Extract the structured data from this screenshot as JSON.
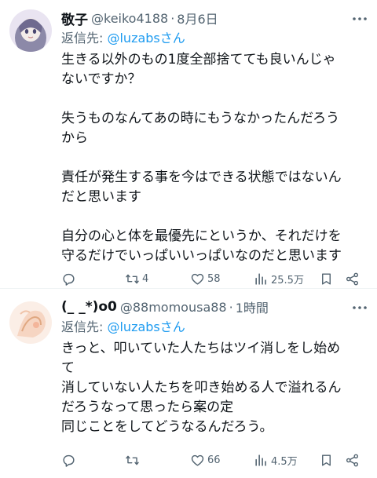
{
  "tweets": [
    {
      "name": "敬子",
      "handle": "@keiko4188",
      "separator": "·",
      "date": "8月6日",
      "reply_prefix": "返信先: ",
      "reply_to": "@luzabsさん",
      "body_lines": [
        "生きる以外のもの1度全部捨てても良いんじゃ",
        "ないですか？",
        "",
        "失うものなんてあの時にもうなかったんだろう",
        "から",
        "",
        "責任が発生する事を今はできる状態ではないん",
        "だと思います",
        "",
        "自分の心と体を最優先にというか、それだけを",
        "守るだけでいっぱいいっぱいなのだと思います"
      ],
      "replies": "",
      "retweets": "4",
      "likes": "58",
      "views": "25.5万"
    },
    {
      "name": "(_ _*)o0",
      "handle": "@88momousa88",
      "separator": "·",
      "date": "1時間",
      "reply_prefix": "返信先: ",
      "reply_to": "@luzabsさん",
      "body_lines": [
        "きっと、叩いていた人たちはツイ消しをし始め",
        "て",
        "消していない人たちを叩き始める人で溢れるん",
        "だろうなって思ったら案の定",
        "同じことをしてどうなるんだろう。"
      ],
      "replies": "",
      "retweets": "",
      "likes": "66",
      "views": "4.5万"
    }
  ],
  "icons": {
    "more": "more-dots-icon",
    "reply": "reply-icon",
    "retweet": "retweet-icon",
    "like": "heart-icon",
    "views": "views-icon",
    "bookmark": "bookmark-icon",
    "share": "share-icon"
  },
  "colors": {
    "text": "#0f1419",
    "secondary": "#536471",
    "mention": "#1d9bf0",
    "divider": "#eff3f4"
  }
}
